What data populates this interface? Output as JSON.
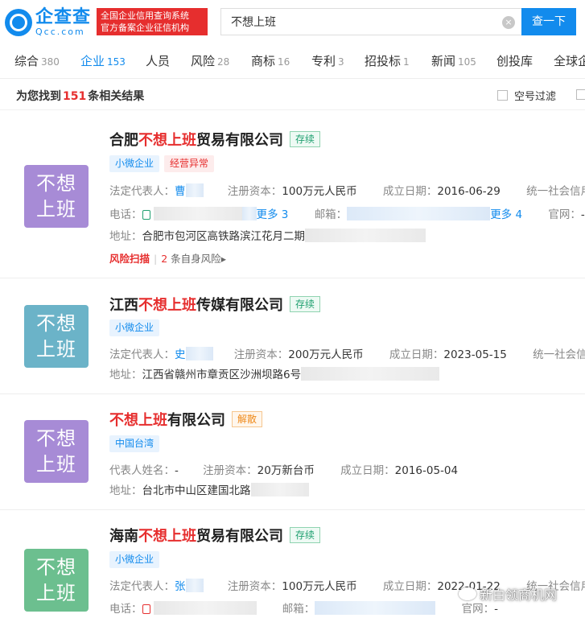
{
  "header": {
    "logo_cn": "企查查",
    "logo_en": "Qcc.com",
    "slogan_line1": "全国企业信用查询系统",
    "slogan_line2": "官方备案企业征信机构",
    "search_value": "不想上班",
    "clear_symbol": "×",
    "search_button": "查一下"
  },
  "tabs": [
    {
      "label": "综合",
      "count": "380"
    },
    {
      "label": "企业",
      "count": "153"
    },
    {
      "label": "人员",
      "count": ""
    },
    {
      "label": "风险",
      "count": "28"
    },
    {
      "label": "商标",
      "count": "16"
    },
    {
      "label": "专利",
      "count": "3"
    },
    {
      "label": "招投标",
      "count": "1"
    },
    {
      "label": "新闻",
      "count": "105"
    },
    {
      "label": "创投库",
      "count": ""
    },
    {
      "label": "全球企",
      "count": ""
    }
  ],
  "result_bar": {
    "prefix": "为您找到",
    "count": "151",
    "suffix": "条相关结果",
    "filter_label": "空号过滤"
  },
  "companies": [
    {
      "avatar_line1": "不想",
      "avatar_line2": "上班",
      "avatar_color": "#a78bd6",
      "name_pre": "合肥",
      "name_hl": "不想上班",
      "name_post": "贸易有限公司",
      "status": "存续",
      "tags": [
        "小微企业",
        "经营异常"
      ],
      "legal_label": "法定代表人：",
      "legal_val": "曹",
      "capital_label": "注册资本：",
      "capital_val": "100万元人民币",
      "date_label": "成立日期：",
      "date_val": "2016-06-29",
      "credit_label": "统一社会信用",
      "phone_label": "电话：",
      "phone_more": "更多 3",
      "email_label": "邮箱：",
      "email_more": "更多 4",
      "web_label": "官网：",
      "web_val": "-",
      "addr_label": "地址：",
      "addr_val": "合肥市包河区高铁路滨江花月二期",
      "risk_title": "风险扫描",
      "risk_count": "2",
      "risk_text": "条自身风险",
      "risk_arrow": "▸"
    },
    {
      "avatar_line1": "不想",
      "avatar_line2": "上班",
      "avatar_color": "#6bb3c8",
      "name_pre": "江西",
      "name_hl": "不想上班",
      "name_post": "传媒有限公司",
      "status": "存续",
      "tags": [
        "小微企业"
      ],
      "legal_label": "法定代表人：",
      "legal_val": "史",
      "capital_label": "注册资本：",
      "capital_val": "200万元人民币",
      "date_label": "成立日期：",
      "date_val": "2023-05-15",
      "credit_label": "统一社会信",
      "addr_label": "地址：",
      "addr_val": "江西省赣州市章贡区沙洲坝路6号"
    },
    {
      "avatar_line1": "不想",
      "avatar_line2": "上班",
      "avatar_color": "#a78bd6",
      "name_pre": "",
      "name_hl": "不想上班",
      "name_post": "有限公司",
      "status": "解散",
      "tags": [
        "中国台湾"
      ],
      "legal_label": "代表人姓名：",
      "legal_val": "-",
      "capital_label": "注册资本：",
      "capital_val": "20万新台币",
      "date_label": "成立日期：",
      "date_val": "2016-05-04",
      "addr_label": "地址：",
      "addr_val": "台北市中山区建国北路"
    },
    {
      "avatar_line1": "不想",
      "avatar_line2": "上班",
      "avatar_color": "#6cbf8f",
      "name_pre": "海南",
      "name_hl": "不想上班",
      "name_post": "贸易有限公司",
      "status": "存续",
      "tags": [
        "小微企业"
      ],
      "legal_label": "法定代表人：",
      "legal_val": "张",
      "capital_label": "注册资本：",
      "capital_val": "100万元人民币",
      "date_label": "成立日期：",
      "date_val": "2022-01-22",
      "credit_label": "统一社会信用",
      "phone_label": "电话：",
      "email_label": "邮箱：",
      "web_label": "官网：",
      "web_val": "-"
    }
  ],
  "watermark": "新白领商机网",
  "colors": {
    "brand": "#128bed",
    "highlight": "#e62e2e",
    "status_green": "#20a070",
    "status_orange": "#ef8a1b"
  }
}
